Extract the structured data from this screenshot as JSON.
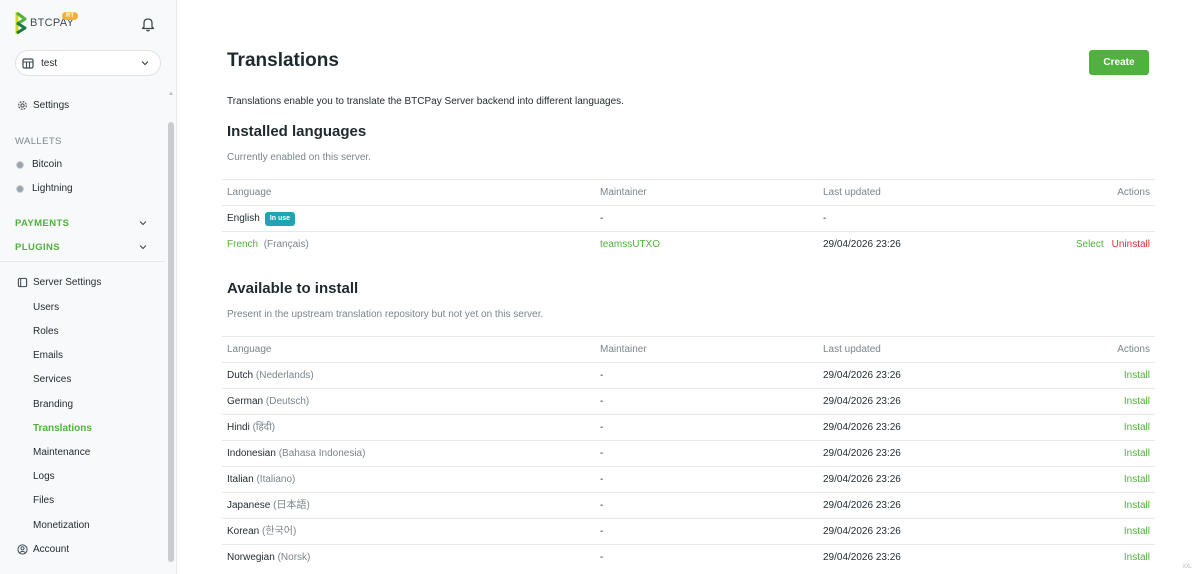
{
  "brand": {
    "name": "BTCPAY",
    "badge": "RT"
  },
  "store": {
    "name": "test"
  },
  "sidebar": {
    "settings_label": "Settings",
    "wallets_header": "WALLETS",
    "wallets": [
      {
        "label": "Bitcoin"
      },
      {
        "label": "Lightning"
      }
    ],
    "groups": [
      {
        "label": "PAYMENTS"
      },
      {
        "label": "PLUGINS"
      }
    ],
    "server_settings_label": "Server Settings",
    "server_items": [
      {
        "label": "Users"
      },
      {
        "label": "Roles"
      },
      {
        "label": "Emails"
      },
      {
        "label": "Services"
      },
      {
        "label": "Branding"
      },
      {
        "label": "Translations"
      },
      {
        "label": "Maintenance"
      },
      {
        "label": "Logs"
      },
      {
        "label": "Files"
      },
      {
        "label": "Monetization"
      }
    ],
    "active_item": "Translations",
    "account_label": "Account"
  },
  "page": {
    "title": "Translations",
    "create_label": "Create",
    "intro": "Translations enable you to translate the BTCPay Server backend into different languages."
  },
  "installed": {
    "heading": "Installed languages",
    "description": "Currently enabled on this server.",
    "columns": {
      "language": "Language",
      "maintainer": "Maintainer",
      "updated": "Last updated",
      "actions": "Actions"
    },
    "rows": [
      {
        "language": "English",
        "badge": "In use",
        "maintainer": "-",
        "updated": "-"
      },
      {
        "language": "French",
        "native": "(Français)",
        "maintainer": "teamssUTXO",
        "updated": "29/04/2026 23:26",
        "action_select": "Select",
        "action_uninstall": "Uninstall"
      }
    ]
  },
  "available": {
    "heading": "Available to install",
    "description": "Present in the upstream translation repository but not yet on this server.",
    "columns": {
      "language": "Language",
      "maintainer": "Maintainer",
      "updated": "Last updated",
      "actions": "Actions"
    },
    "rows": [
      {
        "language": "Dutch",
        "native": "(Nederlands)",
        "maintainer": "-",
        "updated": "29/04/2026 23:26",
        "action": "Install"
      },
      {
        "language": "German",
        "native": "(Deutsch)",
        "maintainer": "-",
        "updated": "29/04/2026 23:26",
        "action": "Install"
      },
      {
        "language": "Hindi",
        "native": "(हिंदी)",
        "maintainer": "-",
        "updated": "29/04/2026 23:26",
        "action": "Install"
      },
      {
        "language": "Indonesian",
        "native": "(Bahasa Indonesia)",
        "maintainer": "-",
        "updated": "29/04/2026 23:26",
        "action": "Install"
      },
      {
        "language": "Italian",
        "native": "(Italiano)",
        "maintainer": "-",
        "updated": "29/04/2026 23:26",
        "action": "Install"
      },
      {
        "language": "Japanese",
        "native": "(日本語)",
        "maintainer": "-",
        "updated": "29/04/2026 23:26",
        "action": "Install"
      },
      {
        "language": "Korean",
        "native": "(한국어)",
        "maintainer": "-",
        "updated": "29/04/2026 23:26",
        "action": "Install"
      },
      {
        "language": "Norwegian",
        "native": "(Norsk)",
        "maintainer": "-",
        "updated": "29/04/2026 23:26",
        "action": "Install"
      }
    ]
  },
  "footer_mark": "XXL",
  "colors": {
    "accent": "#51b13e",
    "danger": "#e0313a",
    "badge": "#1fa4b3",
    "brand_badge": "#f7ae34"
  }
}
